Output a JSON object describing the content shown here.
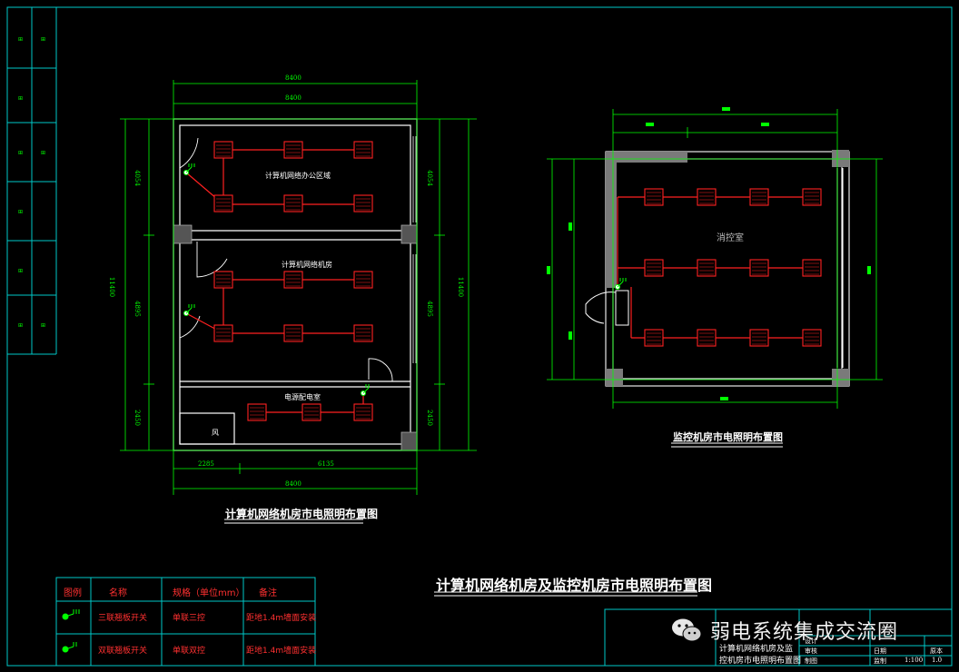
{
  "colors": {
    "background": "#000000",
    "frame": "#00c8c8",
    "dimension": "#00ff00",
    "wall": "#ffffff",
    "fixture": "#ff2020",
    "wiring": "#ff2020",
    "switch": "#00ff00",
    "column": "#808080",
    "title_text": "#ffffff",
    "legend_red": "#ff3030"
  },
  "drawing_left": {
    "title": "计算机网络机房市电照明布置图",
    "dims": {
      "top_outer": "8400",
      "top_inner": "8400",
      "bottom_total": "8400",
      "bottom_left": "2285",
      "bottom_right": "6135",
      "left_total": "11400",
      "left_top": "4054",
      "left_mid": "4895",
      "left_bottom": "2450",
      "right_total": "11400",
      "right_top": "4054",
      "right_mid": "4895",
      "right_bottom": "2450"
    },
    "rooms": {
      "top": "计算机网络办公区域",
      "middle": "计算机网络机房",
      "bottom": "电源配电室",
      "closet": "风"
    }
  },
  "drawing_right": {
    "title": "监控机房市电照明布置图",
    "room": "消控室"
  },
  "sheet_title": "计算机网络机房及监控机房市电照明布置图",
  "legend": {
    "headers": [
      "图例",
      "名称",
      "规格（单位mm）",
      "备注"
    ],
    "rows": [
      {
        "name": "三联翘板开关",
        "spec": "单联三控",
        "note": "距地1.4m墙面安装",
        "icon": "triple-switch-icon"
      },
      {
        "name": "双联翘板开关",
        "spec": "单联双控",
        "note": "距地1.4m墙面安装",
        "icon": "double-switch-icon"
      }
    ]
  },
  "title_block": {
    "drawing_name_line1": "计算机网络机房及监",
    "drawing_name_line2": "控机房市电照明布置图",
    "scale": "1:100",
    "version": "1.0",
    "fields": [
      "设计",
      "审核",
      "制图",
      "日期",
      "监制",
      "原本"
    ]
  },
  "watermark": {
    "text": "弱电系统集成交流圈",
    "icon": "wechat-icon"
  }
}
